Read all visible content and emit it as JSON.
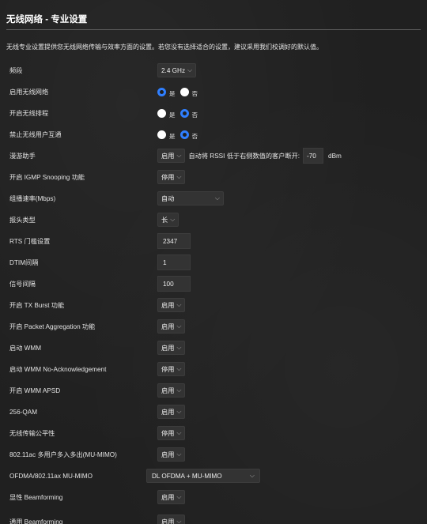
{
  "header": {
    "title": "无线网络 - 专业设置",
    "description": "无线专业设置提供您无线网络传输与效率方面的设置。若您没有选择适合的设置，建议采用我们校调好的默认值。"
  },
  "radio_text": {
    "yes": "是",
    "no": "否"
  },
  "rows": {
    "band": {
      "label": "频段",
      "value": "2.4 GHz"
    },
    "enable_wireless": {
      "label": "启用无线网络",
      "selected": "是"
    },
    "wireless_schedule": {
      "label": "开启无线排程",
      "selected": "否"
    },
    "block_client_comm": {
      "label": "禁止无线用户互通",
      "selected": "否"
    },
    "roaming": {
      "label": "漫游助手",
      "value": "启用",
      "description": "自动将 RSSI 低于右侧数值的客户断开:",
      "rssi": "-70",
      "unit": "dBm"
    },
    "igmp": {
      "label": "开启 IGMP Snooping 功能",
      "value": "停用"
    },
    "multicast_rate": {
      "label": "组播速率(Mbps)",
      "value": "自动"
    },
    "preamble": {
      "label": "报头类型",
      "value": "长"
    },
    "rts": {
      "label": "RTS 门槛设置",
      "value": "2347"
    },
    "dtim": {
      "label": "DTIM间隔",
      "value": "1"
    },
    "beacon": {
      "label": "信号间隔",
      "value": "100"
    },
    "tx_burst": {
      "label": "开启 TX Burst 功能",
      "value": "启用"
    },
    "packet_agg": {
      "label": "开启 Packet Aggregation 功能",
      "value": "启用"
    },
    "wmm": {
      "label": "启动 WMM",
      "value": "启用"
    },
    "wmm_noack": {
      "label": "启动 WMM No-Acknowledgement",
      "value": "停用"
    },
    "wmm_apsd": {
      "label": "开启 WMM APSD",
      "value": "启用"
    },
    "qam256": {
      "label": "256-QAM",
      "value": "启用"
    },
    "airtime": {
      "label": "无线传输公平性",
      "value": "停用"
    },
    "mu_mimo": {
      "label": "802.11ac 多用户多入多出(MU-MIMO)",
      "value": "启用"
    },
    "ofdma": {
      "label": "OFDMA/802.11ax MU-MIMO",
      "value": "DL OFDMA + MU-MIMO"
    },
    "explicit_bf": {
      "label": "显性 Beamforming",
      "value": "启用"
    },
    "universal_bf": {
      "label": "通用 Beamforming",
      "value": "启用"
    }
  },
  "colors": {
    "accent": "#2f7fff",
    "background": "#202020",
    "field": "#333333"
  }
}
